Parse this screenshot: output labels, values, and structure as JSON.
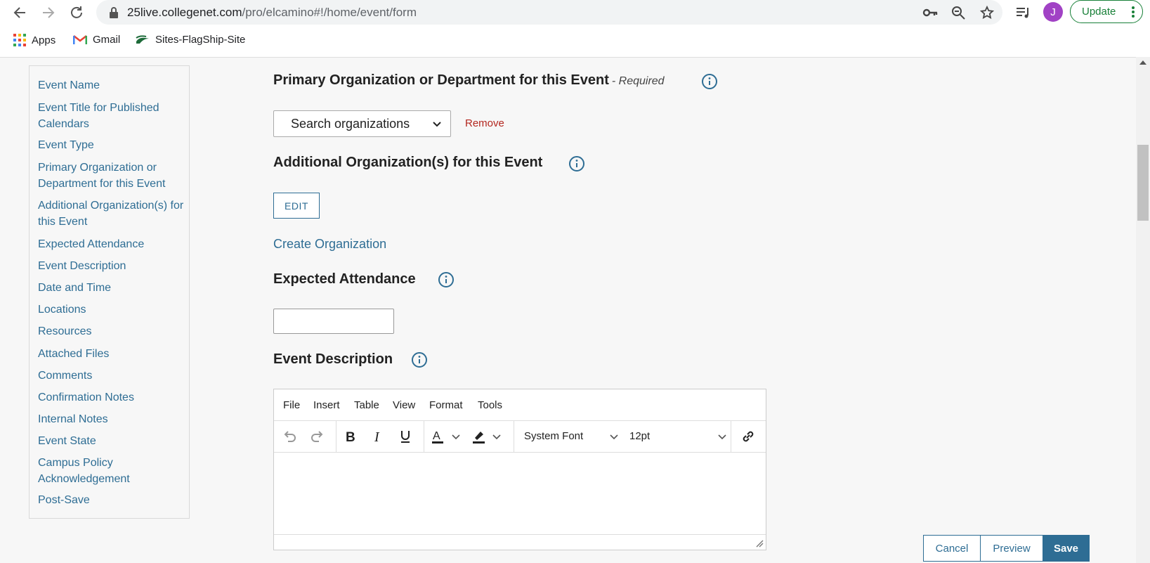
{
  "browser": {
    "url_host": "25live.collegenet.com",
    "url_path": "/pro/elcamino#!/home/event/form",
    "avatar_letter": "J",
    "update_label": "Update"
  },
  "bookmarks": [
    {
      "label": "Apps",
      "icon": "apps-grid-icon"
    },
    {
      "label": "Gmail",
      "icon": "gmail-icon"
    },
    {
      "label": "Sites-FlagShip-Site",
      "icon": "flag-icon"
    }
  ],
  "sidebar": {
    "items": [
      "Event Name",
      "Event Title for Published Calendars",
      "Event Type",
      "Primary Organization or Department for this Event",
      "Additional Organization(s) for this Event",
      "Expected Attendance",
      "Event Description",
      "Date and Time",
      "Locations",
      "Resources",
      "Attached Files",
      "Comments",
      "Confirmation Notes",
      "Internal Notes",
      "Event State",
      "Campus Policy Acknowledgement",
      "Post-Save"
    ]
  },
  "form": {
    "primary_org_title": "Primary Organization or Department for this Event",
    "primary_org_required": "- Required",
    "org_select_placeholder": "Search organizations",
    "remove_label": "Remove",
    "additional_org_title": "Additional Organization(s) for this Event",
    "edit_label": "EDIT",
    "create_org_label": "Create Organization",
    "attendance_title": "Expected Attendance",
    "attendance_value": "",
    "description_title": "Event Description"
  },
  "editor": {
    "menu": [
      "File",
      "Insert",
      "Table",
      "View",
      "Format",
      "Tools"
    ],
    "font_family": "System Font",
    "font_size": "12pt",
    "accent_color": "#2e6d94"
  },
  "actions": {
    "cancel": "Cancel",
    "preview": "Preview",
    "save": "Save"
  }
}
